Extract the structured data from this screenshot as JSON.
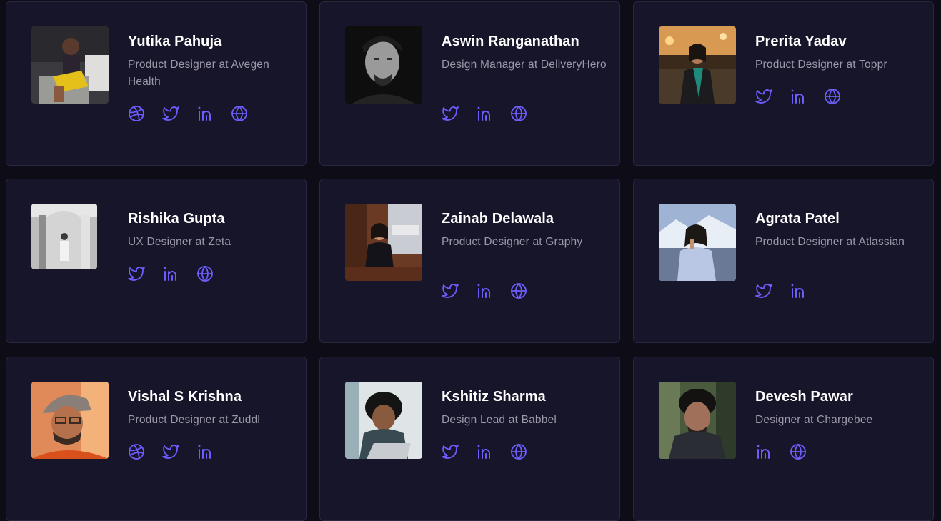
{
  "accent": "#6d5dfc",
  "people": [
    {
      "name": "Yutika Pahuja",
      "role": "Product Designer at Avegen Health",
      "socials": [
        "dribbble-icon",
        "twitter-icon",
        "linkedin-icon",
        "globe-icon"
      ]
    },
    {
      "name": "Aswin Ranganathan",
      "role": "Design Manager at DeliveryHero",
      "socials": [
        "twitter-icon",
        "linkedin-icon",
        "globe-icon"
      ]
    },
    {
      "name": "Prerita Yadav",
      "role": "Product Designer at Toppr",
      "socials": [
        "twitter-icon",
        "linkedin-icon",
        "globe-icon"
      ]
    },
    {
      "name": "Rishika Gupta",
      "role": "UX Designer at Zeta",
      "socials": [
        "twitter-icon",
        "linkedin-icon",
        "globe-icon"
      ]
    },
    {
      "name": "Zainab Delawala",
      "role": "Product Designer at Graphy",
      "socials": [
        "twitter-icon",
        "linkedin-icon",
        "globe-icon"
      ]
    },
    {
      "name": "Agrata Patel",
      "role": "Product Designer at Atlassian",
      "socials": [
        "twitter-icon",
        "linkedin-icon"
      ]
    },
    {
      "name": "Vishal S Krishna",
      "role": "Product Designer at Zuddl",
      "socials": [
        "dribbble-icon",
        "twitter-icon",
        "linkedin-icon"
      ]
    },
    {
      "name": "Kshitiz Sharma",
      "role": "Design Lead at Babbel",
      "socials": [
        "twitter-icon",
        "linkedin-icon",
        "globe-icon"
      ]
    },
    {
      "name": "Devesh Pawar",
      "role": "Designer at Chargebee",
      "socials": [
        "linkedin-icon",
        "globe-icon"
      ]
    }
  ]
}
